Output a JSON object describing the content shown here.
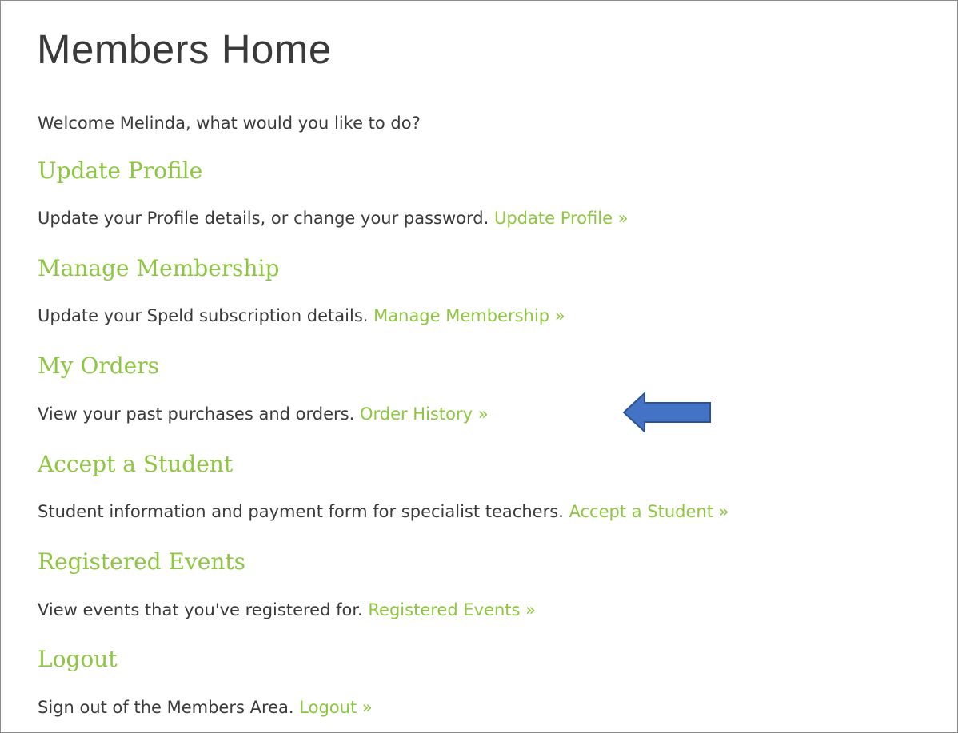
{
  "page": {
    "title": "Members Home",
    "welcome": "Welcome Melinda, what would you like to do?"
  },
  "sections": [
    {
      "heading": "Update Profile",
      "description": "Update your Profile details, or change your password.",
      "link": "Update Profile »"
    },
    {
      "heading": "Manage Membership",
      "description": "Update your Speld subscription details.",
      "link": "Manage Membership »"
    },
    {
      "heading": "My Orders",
      "description": "View your past purchases and orders.",
      "link": "Order History »"
    },
    {
      "heading": "Accept a Student",
      "description": "Student information and payment form for specialist teachers.",
      "link": "Accept a Student »"
    },
    {
      "heading": "Registered Events",
      "description": "View events that you've registered for.",
      "link": "Registered Events »"
    },
    {
      "heading": "Logout",
      "description": "Sign out of the Members Area.",
      "link": "Logout »"
    }
  ],
  "annotation": {
    "icon": "left-arrow-icon",
    "fill_color": "#4472c4",
    "stroke_color": "#2f528f"
  },
  "colors": {
    "accent": "#8dc63f",
    "text": "#3a3a3a"
  }
}
